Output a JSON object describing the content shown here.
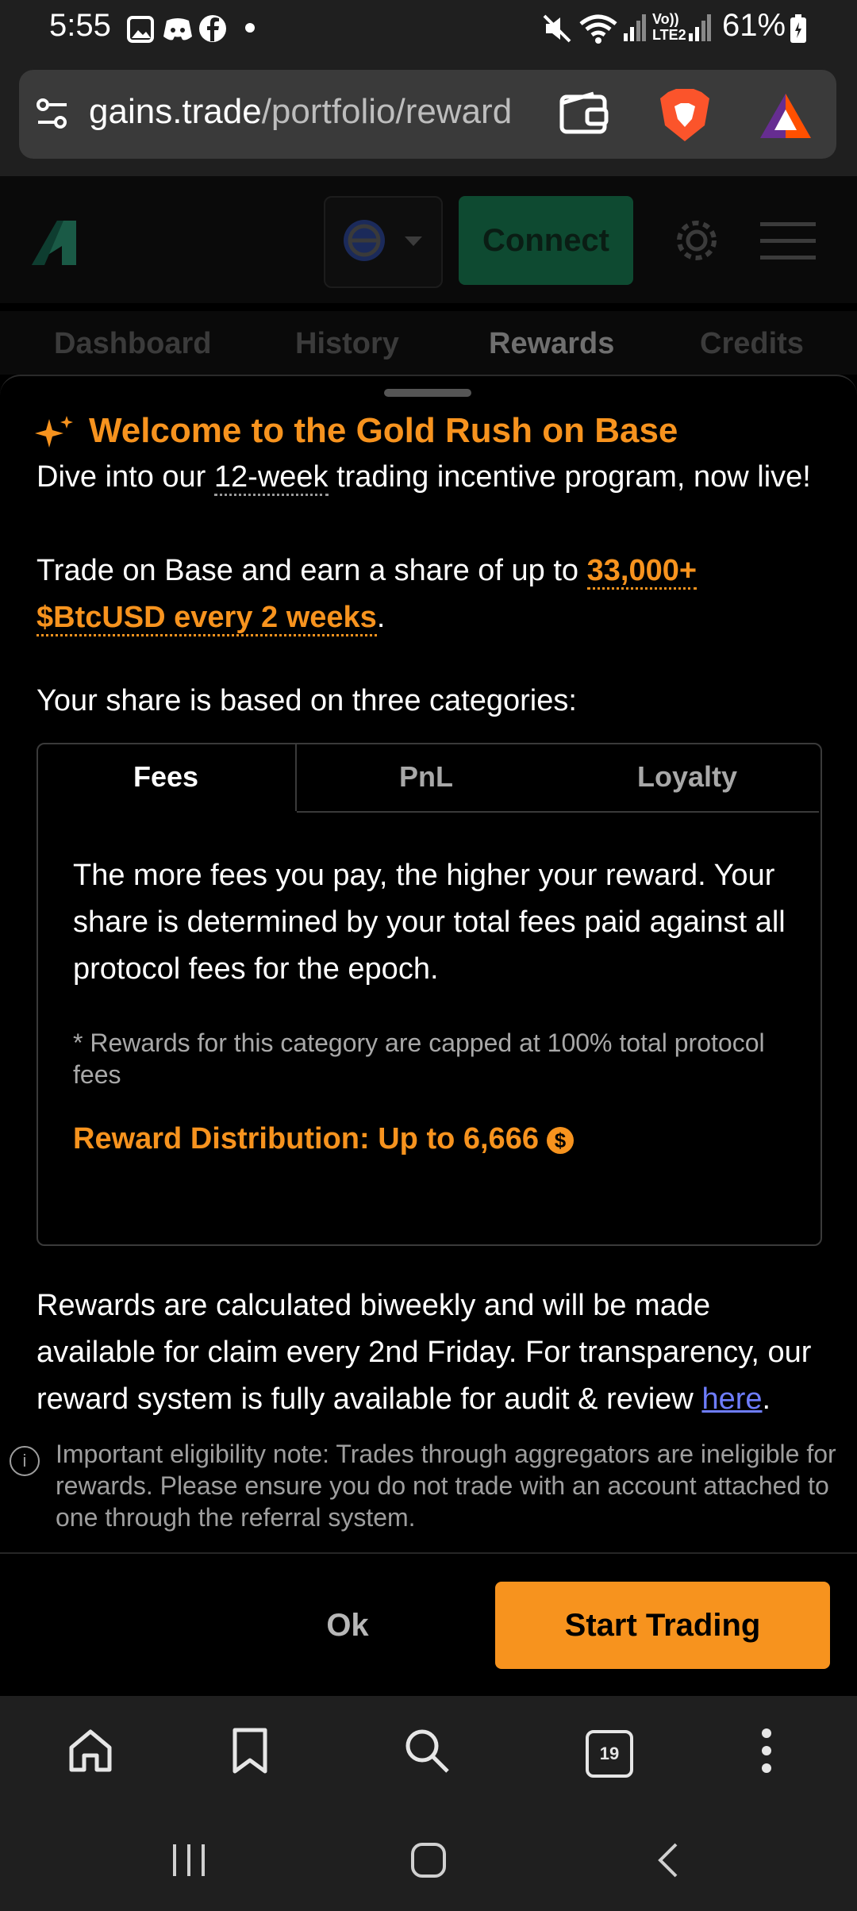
{
  "status_bar": {
    "time": "5:55",
    "battery": "61%",
    "icons": [
      "image-icon",
      "discord-icon",
      "facebook-icon",
      "dot-icon",
      "mute-icon",
      "wifi-icon",
      "signal-icon",
      "volte-icon",
      "signal-icon",
      "battery-icon"
    ]
  },
  "browser": {
    "url_host": "gains.trade",
    "url_path": "/portfolio/reward",
    "tab_count": "19"
  },
  "site": {
    "connect_label": "Connect",
    "nav_tabs": [
      "Dashboard",
      "History",
      "Rewards",
      "Credits"
    ]
  },
  "modal": {
    "title": "Welcome to the Gold Rush on Base",
    "intro_pre": "Dive into our ",
    "intro_link": "12-week",
    "intro_post": " trading incentive program, now live!",
    "trade_pre": "Trade on Base and earn a share of up to ",
    "trade_highlight": "33,000+ $BtcUSD every 2 weeks",
    "trade_post": ".",
    "categories_intro": "Your share is based on three categories:",
    "tabs": [
      "Fees",
      "PnL",
      "Loyalty"
    ],
    "active_tab": "Fees",
    "fees_description": "The more fees you pay, the higher your reward. Your share is determined by your total fees paid against all protocol fees for the epoch.",
    "fees_note": "* Rewards for this category are capped at 100% total protocol fees",
    "distribution": "Reward Distribution: Up to 6,666",
    "calc_pre": "Rewards are calculated biweekly and will be made available for claim every 2nd Friday. For transparency, our reward system is fully available for audit & review ",
    "calc_link": "here",
    "calc_post": ".",
    "eligibility_note": "Important eligibility note: Trades through aggregators are ineligible for rewards. Please ensure you do not trade with an account attached to one through the referral system.",
    "ok_label": "Ok",
    "start_label": "Start Trading"
  },
  "colors": {
    "accent": "#f7931e",
    "link": "#6e7dff",
    "connect_bg": "#0e4a31"
  }
}
